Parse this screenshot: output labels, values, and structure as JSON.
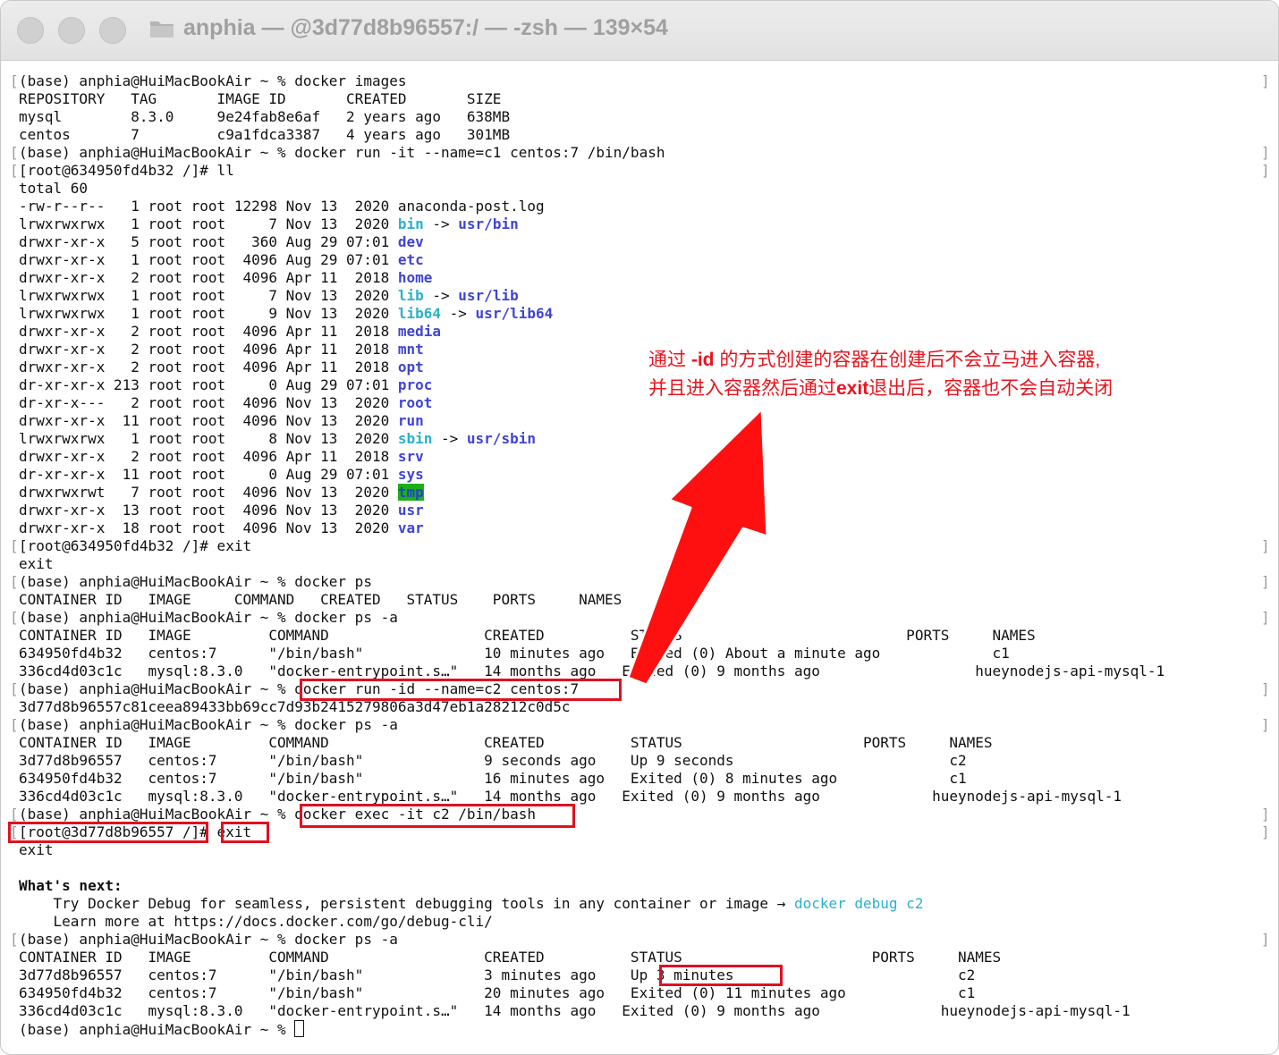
{
  "window": {
    "title": "anphia — @3d77d8b96557:/ — -zsh — 139×54"
  },
  "terminal": {
    "lines": [
      [
        {
          "t": "(base) anphia@HuiMacBookAir ~ % docker images"
        }
      ],
      [
        {
          "t": "REPOSITORY   TAG       IMAGE ID       CREATED       SIZE"
        }
      ],
      [
        {
          "t": "mysql        8.3.0     9e24fab8e6af   2 years ago   638MB"
        }
      ],
      [
        {
          "t": "centos       7         c9a1fdca3387   4 years ago   301MB"
        }
      ],
      [
        {
          "t": "(base) anphia@HuiMacBookAir ~ % docker run -it --name=c1 centos:7 /bin/bash"
        }
      ],
      [
        {
          "t": "[root@634950fd4b32 /]# ll"
        }
      ],
      [
        {
          "t": "total 60"
        }
      ],
      [
        {
          "t": "-rw-r--r--   1 root root 12298 Nov 13  2020 anaconda-post.log"
        }
      ],
      [
        {
          "t": "lrwxrwxrwx   1 root root     7 Nov 13  2020 "
        },
        {
          "t": "bin",
          "c": "lnk"
        },
        {
          "t": " -> "
        },
        {
          "t": "usr/bin",
          "c": "dir"
        }
      ],
      [
        {
          "t": "drwxr-xr-x   5 root root   360 Aug 29 07:01 "
        },
        {
          "t": "dev",
          "c": "dir"
        }
      ],
      [
        {
          "t": "drwxr-xr-x   1 root root  4096 Aug 29 07:01 "
        },
        {
          "t": "etc",
          "c": "dir"
        }
      ],
      [
        {
          "t": "drwxr-xr-x   2 root root  4096 Apr 11  2018 "
        },
        {
          "t": "home",
          "c": "dir"
        }
      ],
      [
        {
          "t": "lrwxrwxrwx   1 root root     7 Nov 13  2020 "
        },
        {
          "t": "lib",
          "c": "lnk"
        },
        {
          "t": " -> "
        },
        {
          "t": "usr/lib",
          "c": "dir"
        }
      ],
      [
        {
          "t": "lrwxrwxrwx   1 root root     9 Nov 13  2020 "
        },
        {
          "t": "lib64",
          "c": "lnk"
        },
        {
          "t": " -> "
        },
        {
          "t": "usr/lib64",
          "c": "dir"
        }
      ],
      [
        {
          "t": "drwxr-xr-x   2 root root  4096 Apr 11  2018 "
        },
        {
          "t": "media",
          "c": "dir"
        }
      ],
      [
        {
          "t": "drwxr-xr-x   2 root root  4096 Apr 11  2018 "
        },
        {
          "t": "mnt",
          "c": "dir"
        }
      ],
      [
        {
          "t": "drwxr-xr-x   2 root root  4096 Apr 11  2018 "
        },
        {
          "t": "opt",
          "c": "dir"
        }
      ],
      [
        {
          "t": "dr-xr-xr-x 213 root root     0 Aug 29 07:01 "
        },
        {
          "t": "proc",
          "c": "dir"
        }
      ],
      [
        {
          "t": "dr-xr-x---   2 root root  4096 Nov 13  2020 "
        },
        {
          "t": "root",
          "c": "dir"
        }
      ],
      [
        {
          "t": "drwxr-xr-x  11 root root  4096 Nov 13  2020 "
        },
        {
          "t": "run",
          "c": "dir"
        }
      ],
      [
        {
          "t": "lrwxrwxrwx   1 root root     8 Nov 13  2020 "
        },
        {
          "t": "sbin",
          "c": "lnk"
        },
        {
          "t": " -> "
        },
        {
          "t": "usr/sbin",
          "c": "dir"
        }
      ],
      [
        {
          "t": "drwxr-xr-x   2 root root  4096 Apr 11  2018 "
        },
        {
          "t": "srv",
          "c": "dir"
        }
      ],
      [
        {
          "t": "dr-xr-xr-x  11 root root     0 Aug 29 07:01 "
        },
        {
          "t": "sys",
          "c": "dir"
        }
      ],
      [
        {
          "t": "drwxrwxrwt   7 root root  4096 Nov 13  2020 "
        },
        {
          "t": "tmp",
          "c": "tmp"
        }
      ],
      [
        {
          "t": "drwxr-xr-x  13 root root  4096 Nov 13  2020 "
        },
        {
          "t": "usr",
          "c": "dir"
        }
      ],
      [
        {
          "t": "drwxr-xr-x  18 root root  4096 Nov 13  2020 "
        },
        {
          "t": "var",
          "c": "dir"
        }
      ],
      [
        {
          "t": "[root@634950fd4b32 /]# exit"
        }
      ],
      [
        {
          "t": "exit"
        }
      ],
      [
        {
          "t": "(base) anphia@HuiMacBookAir ~ % docker ps"
        }
      ],
      [
        {
          "t": "CONTAINER ID   IMAGE     COMMAND   CREATED   STATUS    PORTS     NAMES"
        }
      ],
      [
        {
          "t": "(base) anphia@HuiMacBookAir ~ % docker ps -a"
        }
      ],
      [
        {
          "t": "CONTAINER ID   IMAGE         COMMAND                  CREATED          STATUS                          PORTS     NAMES"
        }
      ],
      [
        {
          "t": "634950fd4b32   centos:7      \"/bin/bash\"              10 minutes ago   Exited (0) About a minute ago             c1"
        }
      ],
      [
        {
          "t": "336cd4d03c1c   mysql:8.3.0   \"docker-entrypoint.s…\"   14 months ago   Exited (0) 9 months ago                  hueynodejs-api-mysql-1"
        }
      ],
      [
        {
          "t": "(base) anphia@HuiMacBookAir ~ % docker run -id --name=c2 centos:7"
        }
      ],
      [
        {
          "t": "3d77d8b96557c81ceea89433bb69cc7d93b2415279806a3d47eb1a28212c0d5c"
        }
      ],
      [
        {
          "t": "(base) anphia@HuiMacBookAir ~ % docker ps -a"
        }
      ],
      [
        {
          "t": "CONTAINER ID   IMAGE         COMMAND                  CREATED          STATUS                     PORTS     NAMES"
        }
      ],
      [
        {
          "t": "3d77d8b96557   centos:7      \"/bin/bash\"              9 seconds ago    Up 9 seconds                         c2"
        }
      ],
      [
        {
          "t": "634950fd4b32   centos:7      \"/bin/bash\"              16 minutes ago   Exited (0) 8 minutes ago             c1"
        }
      ],
      [
        {
          "t": "336cd4d03c1c   mysql:8.3.0   \"docker-entrypoint.s…\"   14 months ago   Exited (0) 9 months ago             hueynodejs-api-mysql-1"
        }
      ],
      [
        {
          "t": "(base) anphia@HuiMacBookAir ~ % docker exec -it c2 /bin/bash"
        }
      ],
      [
        {
          "t": "[root@3d77d8b96557 /]# exit"
        }
      ],
      [
        {
          "t": "exit"
        }
      ],
      [
        {
          "t": ""
        }
      ],
      [
        {
          "t": "What's next:",
          "c": "bold"
        }
      ],
      [
        {
          "t": "    Try Docker Debug for seamless, persistent debugging tools in any container or image → "
        },
        {
          "t": "docker debug c2",
          "c": "cyan"
        }
      ],
      [
        {
          "t": "    Learn more at https://docs.docker.com/go/debug-cli/"
        }
      ],
      [
        {
          "t": "(base) anphia@HuiMacBookAir ~ % docker ps -a"
        }
      ],
      [
        {
          "t": "CONTAINER ID   IMAGE         COMMAND                  CREATED          STATUS                      PORTS     NAMES"
        }
      ],
      [
        {
          "t": "3d77d8b96557   centos:7      \"/bin/bash\"              3 minutes ago    Up 3 minutes                          c2"
        }
      ],
      [
        {
          "t": "634950fd4b32   centos:7      \"/bin/bash\"              20 minutes ago   Exited (0) 11 minutes ago             c1"
        }
      ],
      [
        {
          "t": "336cd4d03c1c   mysql:8.3.0   \"docker-entrypoint.s…\"   14 months ago   Exited (0) 9 months ago              hueynodejs-api-mysql-1"
        }
      ],
      [
        {
          "t": "(base) anphia@HuiMacBookAir ~ % "
        }
      ]
    ]
  },
  "annotation": {
    "line1_a": "通过 ",
    "line1_b": "-id",
    "line1_c": " 的方式创建的容器在创建后不会立马进入容器,",
    "line2_a": "并且进入容器然后通过",
    "line2_b": "exit",
    "line2_c": "退出后，容器也不会自动关闭"
  },
  "colors": {
    "annotation": "#e8141e",
    "dir": "#3f44d6",
    "link": "#2ab1c9",
    "tmp_bg": "#1db016"
  }
}
